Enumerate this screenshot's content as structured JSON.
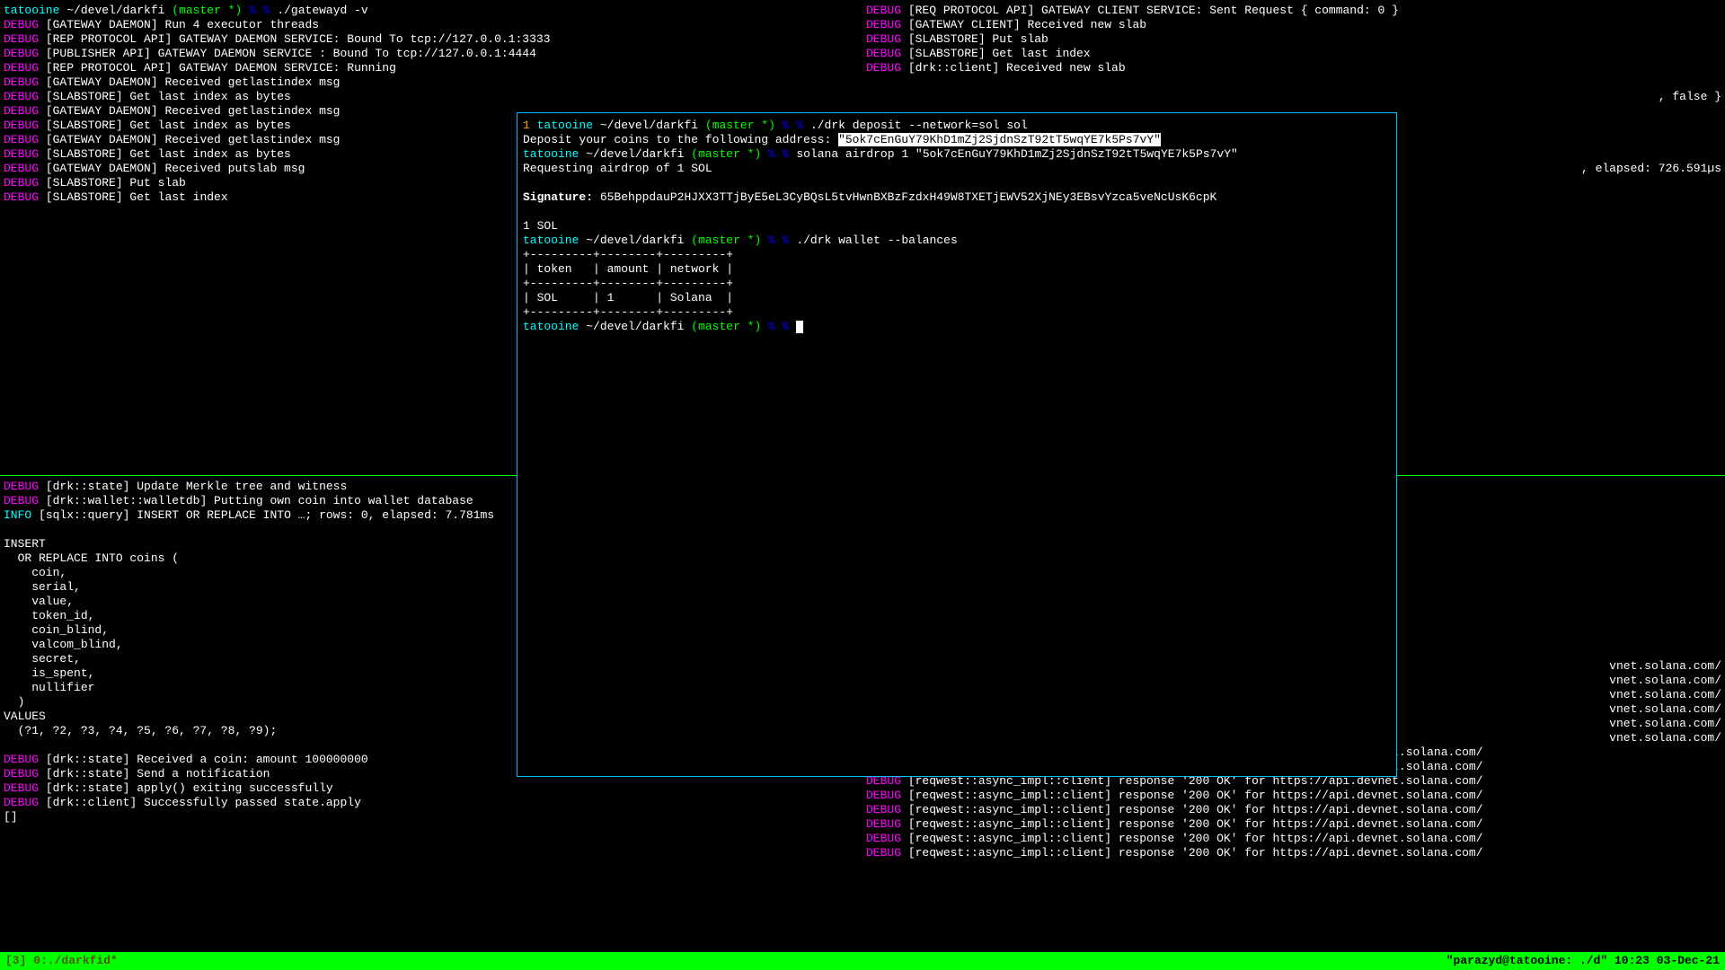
{
  "panes": {
    "tl": {
      "prompt_host": "tatooine",
      "prompt_path": "~/devel/darkfi",
      "prompt_branch": "(master *)",
      "prompt_sym1": "%",
      "prompt_sym2": "%",
      "cmd": "./gatewayd -v",
      "lines": [
        {
          "tag": "DEBUG",
          "txt": "[GATEWAY DAEMON] Run 4 executor threads"
        },
        {
          "tag": "DEBUG",
          "txt": "[REP PROTOCOL API] GATEWAY DAEMON SERVICE: Bound To tcp://127.0.0.1:3333"
        },
        {
          "tag": "DEBUG",
          "txt": "[PUBLISHER API] GATEWAY DAEMON SERVICE : Bound To tcp://127.0.0.1:4444"
        },
        {
          "tag": "DEBUG",
          "txt": "[REP PROTOCOL API] GATEWAY DAEMON SERVICE: Running"
        },
        {
          "tag": "DEBUG",
          "txt": "[GATEWAY DAEMON] Received getlastindex msg"
        },
        {
          "tag": "DEBUG",
          "txt": "[SLABSTORE] Get last index as bytes"
        },
        {
          "tag": "DEBUG",
          "txt": "[GATEWAY DAEMON] Received getlastindex msg"
        },
        {
          "tag": "DEBUG",
          "txt": "[SLABSTORE] Get last index as bytes"
        },
        {
          "tag": "DEBUG",
          "txt": "[GATEWAY DAEMON] Received getlastindex msg"
        },
        {
          "tag": "DEBUG",
          "txt": "[SLABSTORE] Get last index as bytes"
        },
        {
          "tag": "DEBUG",
          "txt": "[GATEWAY DAEMON] Received putslab msg"
        },
        {
          "tag": "DEBUG",
          "txt": "[SLABSTORE] Put slab"
        },
        {
          "tag": "DEBUG",
          "txt": "[SLABSTORE] Get last index"
        }
      ]
    },
    "tr": {
      "lines": [
        {
          "tag": "DEBUG",
          "txt": "[REQ PROTOCOL API] GATEWAY CLIENT SERVICE: Sent Request { command: 0 }"
        },
        {
          "tag": "DEBUG",
          "txt": "[GATEWAY CLIENT] Received new slab"
        },
        {
          "tag": "DEBUG",
          "txt": "[SLABSTORE] Put slab"
        },
        {
          "tag": "DEBUG",
          "txt": "[SLABSTORE] Get last index"
        },
        {
          "tag": "DEBUG",
          "txt": "[drk::client] Received new slab"
        }
      ],
      "peek_false": ", false }",
      "peek_elapsed": ", elapsed: 726.591µs"
    },
    "bl": {
      "lines_top": [
        {
          "tag": "DEBUG",
          "txt": "[drk::state] Update Merkle tree and witness"
        },
        {
          "tag": "DEBUG",
          "txt": "[drk::wallet::walletdb] Putting own coin into wallet database"
        },
        {
          "tag": "INFO",
          "txt": "[sqlx::query] INSERT OR REPLACE INTO …; rows: 0, elapsed: 7.781ms"
        }
      ],
      "sql_block": [
        "",
        "INSERT",
        "  OR REPLACE INTO coins (",
        "    coin,",
        "    serial,",
        "    value,",
        "    token_id,",
        "    coin_blind,",
        "    valcom_blind,",
        "    secret,",
        "    is_spent,",
        "    nullifier",
        "  )",
        "VALUES",
        "  (?1, ?2, ?3, ?4, ?5, ?6, ?7, ?8, ?9);"
      ],
      "lines_bot": [
        {
          "tag": "DEBUG",
          "txt": "[drk::state] Received a coin: amount 100000000"
        },
        {
          "tag": "DEBUG",
          "txt": "[drk::state] Send a notification"
        },
        {
          "tag": "DEBUG",
          "txt": "[drk::state] apply() exiting successfully"
        },
        {
          "tag": "DEBUG",
          "txt": "[drk::client] Successfully passed state.apply"
        }
      ],
      "last_line": "[]"
    },
    "br": {
      "peek_urls": [
        "vnet.solana.com/",
        "vnet.solana.com/",
        "vnet.solana.com/",
        "vnet.solana.com/",
        "vnet.solana.com/",
        "vnet.solana.com/"
      ],
      "lines": [
        {
          "tag": "DEBUG",
          "txt": "[reqwest::async_impl::client] response '200 OK' for https://api.devnet.solana.com/"
        },
        {
          "tag": "DEBUG",
          "txt": "[reqwest::async_impl::client] response '200 OK' for https://api.devnet.solana.com/"
        },
        {
          "tag": "DEBUG",
          "txt": "[reqwest::async_impl::client] response '200 OK' for https://api.devnet.solana.com/"
        },
        {
          "tag": "DEBUG",
          "txt": "[reqwest::async_impl::client] response '200 OK' for https://api.devnet.solana.com/"
        },
        {
          "tag": "DEBUG",
          "txt": "[reqwest::async_impl::client] response '200 OK' for https://api.devnet.solana.com/"
        },
        {
          "tag": "DEBUG",
          "txt": "[reqwest::async_impl::client] response '200 OK' for https://api.devnet.solana.com/"
        },
        {
          "tag": "DEBUG",
          "txt": "[reqwest::async_impl::client] response '200 OK' for https://api.devnet.solana.com/"
        },
        {
          "tag": "DEBUG",
          "txt": "[reqwest::async_impl::client] response '200 OK' for https://api.devnet.solana.com/"
        }
      ]
    }
  },
  "float": {
    "p1_num": "1",
    "p1_host": "tatooine",
    "p1_path": "~/devel/darkfi",
    "p1_branch": "(master *)",
    "p1_sym": "% %",
    "p1_cmd": "./drk deposit --network=sol sol",
    "p1_deposit_label": "Deposit your coins to the following address:",
    "p1_address": "\"5ok7cEnGuY79KhD1mZj2SjdnSzT92tT5wqYE7k5Ps7vY\"",
    "p2_host": "tatooine",
    "p2_path": "~/devel/darkfi",
    "p2_branch": "(master *)",
    "p2_cmd": "solana airdrop 1 \"5ok7cEnGuY79KhD1mZj2SjdnSzT92tT5wqYE7k5Ps7vY\"",
    "p2_req": "Requesting airdrop of 1 SOL",
    "sig_label": "Signature:",
    "sig_val": "65BehppdauP2HJXX3TTjByE5eL3CyBQsL5tvHwnBXBzFzdxH49W8TXETjEWV52XjNEy3EBsvYzca5veNcUsK6cpK",
    "onesol": "1 SOL",
    "p3_host": "tatooine",
    "p3_path": "~/devel/darkfi",
    "p3_branch": "(master *)",
    "p3_cmd": "./drk wallet --balances",
    "tbl_border": "+---------+--------+---------+",
    "tbl_header": "| token   | amount | network |",
    "tbl_row": "| SOL     | 1      | Solana  |",
    "p4_host": "tatooine",
    "p4_path": "~/devel/darkfi",
    "p4_branch": "(master *)"
  },
  "statusbar": {
    "left": "[3] 0:./darkfid*",
    "right": "\"parazyd@tatooine: ./d\" 10:23 03-Dec-21"
  }
}
